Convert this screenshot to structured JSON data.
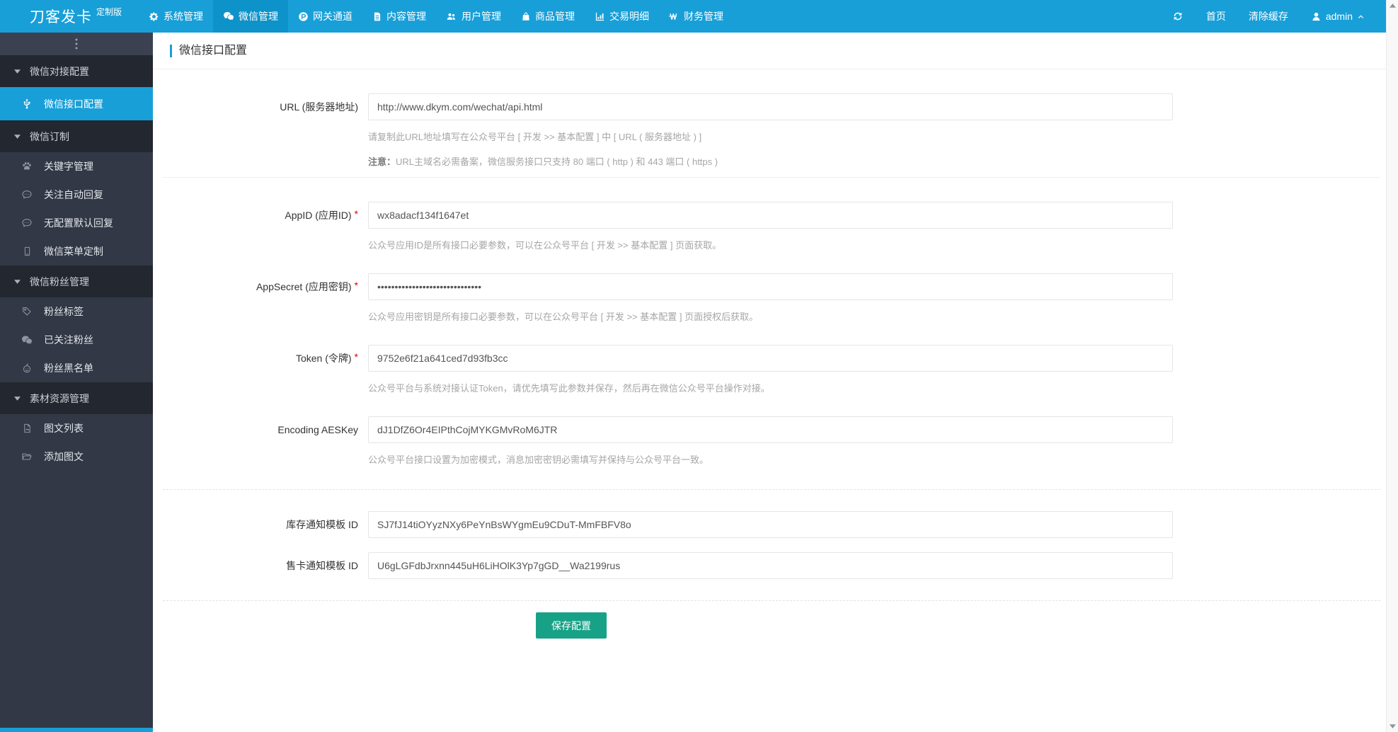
{
  "navbar": {
    "brand": "刀客发卡",
    "brand_badge": "定制版",
    "items": [
      {
        "label": "系统管理",
        "icon": "gear-icon",
        "active": false
      },
      {
        "label": "微信管理",
        "icon": "wechat-icon",
        "active": true
      },
      {
        "label": "网关通道",
        "icon": "gateway-p-icon",
        "active": false
      },
      {
        "label": "内容管理",
        "icon": "content-file-icon",
        "active": false
      },
      {
        "label": "用户管理",
        "icon": "users-icon",
        "active": false
      },
      {
        "label": "商品管理",
        "icon": "shopping-bag-icon",
        "active": false
      },
      {
        "label": "交易明细",
        "icon": "bar-chart-icon",
        "active": false
      },
      {
        "label": "财务管理",
        "icon": "money-won-icon",
        "active": false
      }
    ],
    "right": {
      "refresh_icon": "refresh-icon",
      "home": "首页",
      "clear_cache": "清除缓存",
      "user_icon": "user-icon",
      "username": "admin",
      "caret_icon": "chevron-up-icon"
    }
  },
  "sidebar": {
    "toggle_icon": "ellipsis-v-icon",
    "groups": [
      {
        "label": "微信对接配置",
        "items": [
          {
            "label": "微信接口配置",
            "icon": "usb-icon",
            "active": true
          }
        ]
      },
      {
        "label": "微信订制",
        "items": [
          {
            "label": "关键字管理",
            "icon": "paw-icon",
            "active": false
          },
          {
            "label": "关注自动回复",
            "icon": "comment-dots-icon",
            "active": false
          },
          {
            "label": "无配置默认回复",
            "icon": "comment-dots-icon",
            "active": false
          },
          {
            "label": "微信菜单定制",
            "icon": "mobile-icon",
            "active": false
          }
        ]
      },
      {
        "label": "微信粉丝管理",
        "items": [
          {
            "label": "粉丝标签",
            "icon": "tag-icon",
            "active": false
          },
          {
            "label": "已关注粉丝",
            "icon": "wechat-icon",
            "active": false
          },
          {
            "label": "粉丝黑名单",
            "icon": "blacklist-face-icon",
            "active": false
          }
        ]
      },
      {
        "label": "素材资源管理",
        "items": [
          {
            "label": "图文列表",
            "icon": "image-file-icon",
            "active": false
          },
          {
            "label": "添加图文",
            "icon": "folder-open-icon",
            "active": false
          }
        ]
      }
    ]
  },
  "page": {
    "title": "微信接口配置"
  },
  "form": {
    "required_mark": "*",
    "url": {
      "label": "URL (服务器地址)",
      "value": "http://www.dkym.com/wechat/api.html",
      "hint": "请复制此URL地址填写在公众号平台 [ 开发 >> 基本配置 ] 中 [ URL ( 服务器地址 ) ]",
      "note_prefix": "注意：",
      "note": "URL主域名必需备案，微信服务接口只支持 80 端口 ( http ) 和 443 端口 ( https )"
    },
    "appid": {
      "label": "AppID (应用ID)",
      "value": "wx8adacf134f1647et",
      "hint": "公众号应用ID是所有接口必要参数，可以在公众号平台 [ 开发 >> 基本配置 ] 页面获取。"
    },
    "appsecret": {
      "label": "AppSecret (应用密钥)",
      "value": "••••••••••••••••••••••••••••••",
      "hint": "公众号应用密钥是所有接口必要参数，可以在公众号平台 [ 开发 >> 基本配置 ] 页面授权后获取。"
    },
    "token": {
      "label": "Token (令牌)",
      "value": "9752e6f21a641ced7d93fb3cc",
      "hint": "公众号平台与系统对接认证Token，请优先填写此参数并保存，然后再在微信公众号平台操作对接。"
    },
    "aeskey": {
      "label": "Encoding AESKey",
      "value": "dJ1DfZ6Or4EIPthCojMYKGMvRoM6JTR",
      "hint": "公众号平台接口设置为加密模式，消息加密密钥必需填写并保持与公众号平台一致。"
    },
    "stock_tpl": {
      "label": "库存通知模板 ID",
      "value": "SJ7fJ14tiOYyzNXy6PeYnBsWYgmEu9CDuT-MmFBFV8o"
    },
    "card_tpl": {
      "label": "售卡通知模板 ID",
      "value": "U6gLGFdbJrxnn445uH6LiHOlK3Yp7gGD__Wa2199rus"
    },
    "save_label": "保存配置"
  },
  "colors": {
    "navbar": "#189fd8",
    "navbar_active": "#0d93c9",
    "sidebar": "#323845",
    "sidebar_group": "#23272f",
    "active_item": "#189fd8",
    "save_button": "#17a287",
    "required": "#e60000"
  }
}
